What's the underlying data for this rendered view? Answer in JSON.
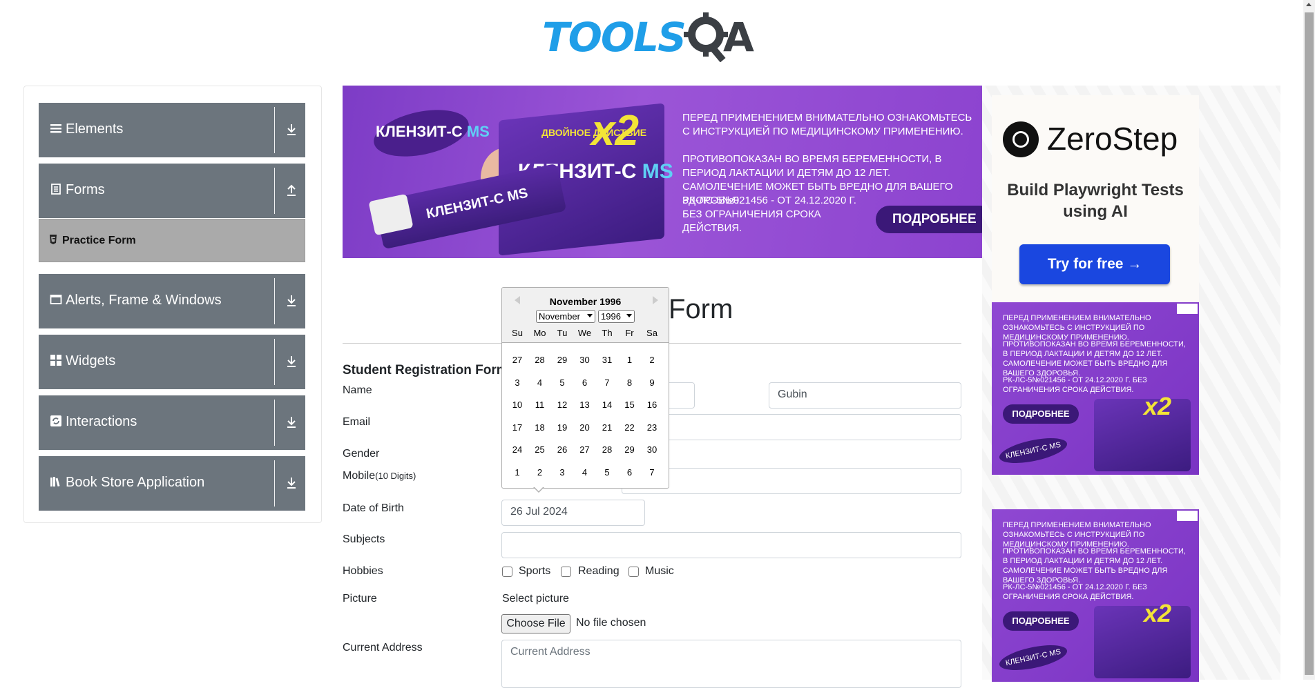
{
  "logo": {
    "text_tools": "TOOLS",
    "text_a": "A",
    "alt": "TOOLSQA"
  },
  "sidebar": {
    "groups": [
      {
        "label": "Elements",
        "icon": "hamburger-icon",
        "arrow": "download-arrow-icon"
      },
      {
        "label": "Forms",
        "icon": "document-icon",
        "arrow": "upload-arrow-icon"
      },
      {
        "label": "Alerts, Frame & Windows",
        "icon": "window-icon",
        "arrow": "download-arrow-icon"
      },
      {
        "label": "Widgets",
        "icon": "grid-icon",
        "arrow": "download-arrow-icon"
      },
      {
        "label": "Interactions",
        "icon": "cycle-icon",
        "arrow": "download-arrow-icon"
      },
      {
        "label": "Book Store Application",
        "icon": "books-icon",
        "arrow": "download-arrow-icon"
      }
    ],
    "active_item": {
      "label": "Practice Form",
      "icon": "html5-icon"
    }
  },
  "banner_ad": {
    "brand": "КЛЕНЗИТ-С",
    "brand_suffix": "MS",
    "x2": "x2",
    "action": "ДВОЙНОЕ ДЕЙСТВИЕ",
    "warning_1": "ПЕРЕД ПРИМЕНЕНИЕМ ВНИМАТЕЛЬНО ОЗНАКОМЬТЕСЬ С ИНСТРУКЦИЕЙ ПО МЕДИЦИНСКОМУ ПРИМЕНЕНИЮ.",
    "warning_2": "ПРОТИВОПОКАЗАН ВО ВРЕМЯ БЕРЕМЕННОСТИ, В ПЕРИОД ЛАКТАЦИИ И ДЕТЯМ ДО 12 ЛЕТ. САМОЛЕЧЕНИЕ МОЖЕТ БЫТЬ ВРЕДНО ДЛЯ ВАШЕГО ЗДОРОВЬЯ.",
    "warning_3": "РК-ЛС-5№021456 - ОТ 24.12.2020 Г. БЕЗ ОГРАНИЧЕНИЯ СРОКА ДЕЙСТВИЯ.",
    "button": "ПОДРОБНЕЕ"
  },
  "form": {
    "title": "Form",
    "subtitle": "Student Registration Form",
    "labels": {
      "name": "Name",
      "email": "Email",
      "gender": "Gender",
      "mobile": "Mobile",
      "mobile_hint": "(10 Digits)",
      "dob": "Date of Birth",
      "subjects": "Subjects",
      "hobbies": "Hobbies",
      "picture": "Picture",
      "address": "Current Address"
    },
    "last_name_value": "Gubin",
    "dob_value": "26 Jul 2024",
    "hobbies": [
      "Sports",
      "Reading",
      "Music"
    ],
    "select_picture": "Select picture",
    "choose_file": "Choose File",
    "no_file": "No file chosen",
    "address_placeholder": "Current Address"
  },
  "datepicker": {
    "header": "November 1996",
    "month_select": "November",
    "year_select": "1996",
    "day_names": [
      "Su",
      "Mo",
      "Tu",
      "We",
      "Th",
      "Fr",
      "Sa"
    ],
    "weeks": [
      [
        "27",
        "28",
        "29",
        "30",
        "31",
        "1",
        "2"
      ],
      [
        "3",
        "4",
        "5",
        "6",
        "7",
        "8",
        "9"
      ],
      [
        "10",
        "11",
        "12",
        "13",
        "14",
        "15",
        "16"
      ],
      [
        "17",
        "18",
        "19",
        "20",
        "21",
        "22",
        "23"
      ],
      [
        "24",
        "25",
        "26",
        "27",
        "28",
        "29",
        "30"
      ],
      [
        "1",
        "2",
        "3",
        "4",
        "5",
        "6",
        "7"
      ]
    ]
  },
  "right_ads": {
    "zerostep_name": "ZeroStep",
    "zerostep_sub": "Build Playwright Tests using AI",
    "zerostep_btn": "Try for free →",
    "sq_text_1": "ПЕРЕД ПРИМЕНЕНИЕМ ВНИМАТЕЛЬНО ОЗНАКОМЬТЕСЬ С ИНСТРУКЦИЕЙ ПО МЕДИЦИНСКОМУ ПРИМЕНЕНИЮ.",
    "sq_text_2": "ПРОТИВОПОКАЗАН ВО ВРЕМЯ БЕРЕМЕННОСТИ, В ПЕРИОД ЛАКТАЦИИ И ДЕТЯМ ДО 12 ЛЕТ. САМОЛЕЧЕНИЕ МОЖЕТ БЫТЬ ВРЕДНО ДЛЯ ВАШЕГО ЗДОРОВЬЯ.",
    "sq_text_3": "РК-ЛС-5№021456 - ОТ 24.12.2020 Г. БЕЗ ОГРАНИЧЕНИЯ СРОКА ДЕЙСТВИЯ.",
    "sq_button": "ПОДРОБНЕЕ",
    "sq_brand": "КЛЕНЗИТ-С MS"
  },
  "colors": {
    "sidebar_group": "#6c757d",
    "active_item": "#aaaaaa",
    "brand_blue": "#1f9ee8",
    "ad_purple": "#8c43cf",
    "zerostep_button": "#1a47e0"
  }
}
